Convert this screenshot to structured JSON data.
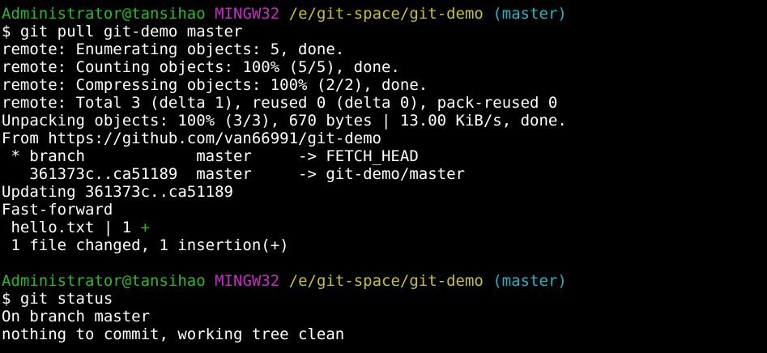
{
  "colors": {
    "background": "#000000",
    "text": "#ffffff",
    "user_host": "#25bc24",
    "system": "#c929c6",
    "path": "#c6c323",
    "branch": "#21b6c4",
    "diff_plus": "#25bc24"
  },
  "prompt": {
    "user_host": "Administrator@tansihao",
    "system": "MINGW32",
    "path": "/e/git-space/git-demo",
    "branch": "(master)"
  },
  "lines": [
    {
      "kind": "prompt"
    },
    {
      "kind": "text",
      "segments": [
        {
          "text": "$ git pull git-demo master",
          "color": "text"
        }
      ]
    },
    {
      "kind": "text",
      "segments": [
        {
          "text": "remote: Enumerating objects: 5, done.",
          "color": "text"
        }
      ]
    },
    {
      "kind": "text",
      "segments": [
        {
          "text": "remote: Counting objects: 100% (5/5), done.",
          "color": "text"
        }
      ]
    },
    {
      "kind": "text",
      "segments": [
        {
          "text": "remote: Compressing objects: 100% (2/2), done.",
          "color": "text"
        }
      ]
    },
    {
      "kind": "text",
      "segments": [
        {
          "text": "remote: Total 3 (delta 1), reused 0 (delta 0), pack-reused 0",
          "color": "text"
        }
      ]
    },
    {
      "kind": "text",
      "segments": [
        {
          "text": "Unpacking objects: 100% (3/3), 670 bytes | 13.00 KiB/s, done.",
          "color": "text"
        }
      ]
    },
    {
      "kind": "text",
      "segments": [
        {
          "text": "From https://github.com/van66991/git-demo",
          "color": "text"
        }
      ]
    },
    {
      "kind": "text",
      "segments": [
        {
          "text": " * branch            master     -> FETCH_HEAD",
          "color": "text"
        }
      ]
    },
    {
      "kind": "text",
      "segments": [
        {
          "text": "   361373c..ca51189  master     -> git-demo/master",
          "color": "text"
        }
      ]
    },
    {
      "kind": "text",
      "segments": [
        {
          "text": "Updating 361373c..ca51189",
          "color": "text"
        }
      ]
    },
    {
      "kind": "text",
      "segments": [
        {
          "text": "Fast-forward",
          "color": "text"
        }
      ]
    },
    {
      "kind": "text",
      "segments": [
        {
          "text": " hello.txt | 1 ",
          "color": "text"
        },
        {
          "text": "+",
          "color": "diff_plus"
        }
      ]
    },
    {
      "kind": "text",
      "segments": [
        {
          "text": " 1 file changed, 1 insertion(+)",
          "color": "text"
        }
      ]
    },
    {
      "kind": "text",
      "segments": [
        {
          "text": "",
          "color": "text"
        }
      ]
    },
    {
      "kind": "prompt"
    },
    {
      "kind": "text",
      "segments": [
        {
          "text": "$ git status",
          "color": "text"
        }
      ]
    },
    {
      "kind": "text",
      "segments": [
        {
          "text": "On branch master",
          "color": "text"
        }
      ]
    },
    {
      "kind": "text",
      "segments": [
        {
          "text": "nothing to commit, working tree clean",
          "color": "text"
        }
      ]
    }
  ]
}
